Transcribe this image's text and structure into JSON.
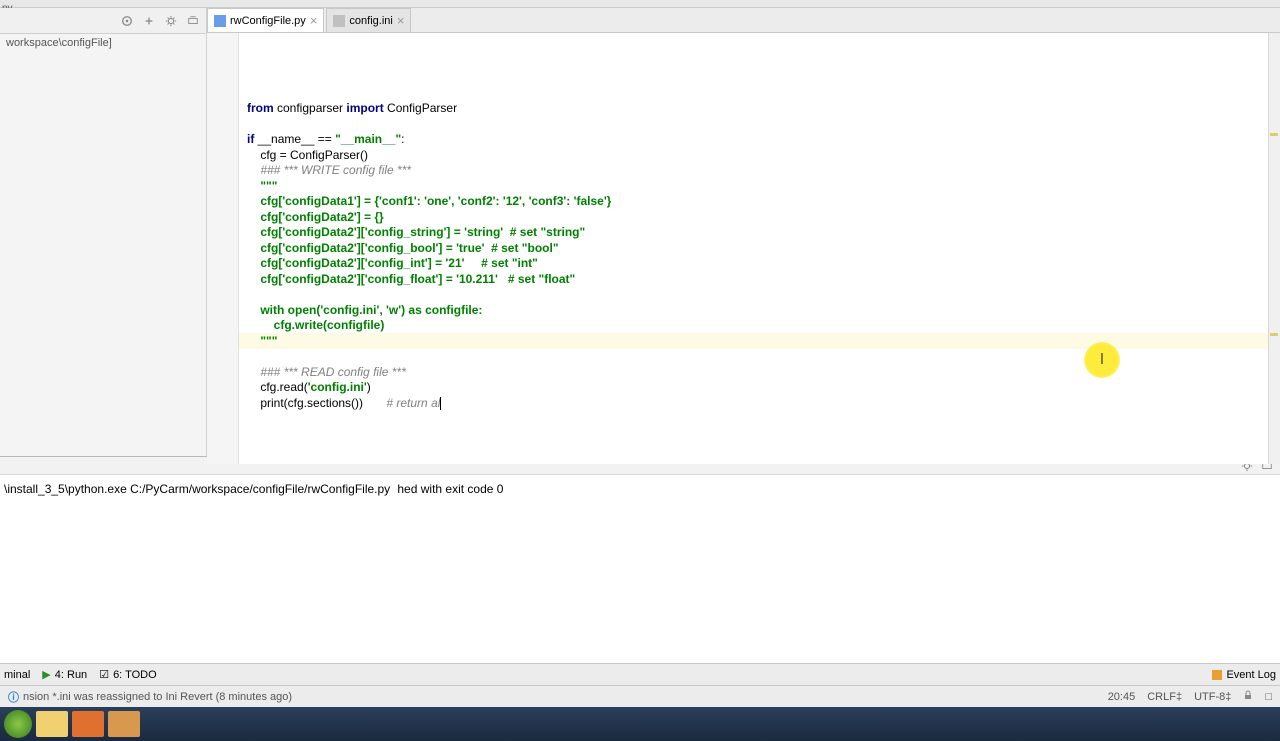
{
  "titlebar": {
    "suffix": "py"
  },
  "breadcrumb": {
    "path": "workspace\\configFile]"
  },
  "tabs": [
    {
      "label": "rwConfigFile.py",
      "active": true
    },
    {
      "label": "config.ini",
      "active": false
    }
  ],
  "code": {
    "l1a": "from ",
    "l1b": "configparser ",
    "l1c": "import ",
    "l1d": "ConfigParser",
    "l3a": "if ",
    "l3b": "__name__ == ",
    "l3c": "\"__main__\"",
    "l3d": ":",
    "l4": "    cfg = ConfigParser()",
    "l5": "    ### *** WRITE config file ***",
    "l6": "    \"\"\"",
    "l7a": "    cfg['configData1'] = {'conf1': 'one', 'conf2': '12', 'conf3': 'false'}",
    "l8": "    cfg['configData2'] = {}",
    "l9": "    cfg['configData2']['config_string'] = 'string'  # set \"string\"",
    "l10": "    cfg['configData2']['config_bool'] = 'true'  # set \"bool\"",
    "l11": "    cfg['configData2']['config_int'] = '21'     # set \"int\"",
    "l12": "    cfg['configData2']['config_float'] = '10.211'   # set \"float\"",
    "l14": "    with open('config.ini', 'w') as configfile:",
    "l15": "        cfg.write(configfile)",
    "l16": "    \"\"\"",
    "l18": "    ### *** READ config file ***",
    "l19a": "    cfg.read(",
    "l19b": "'config.ini'",
    "l19c": ")",
    "l20a": "    print(cfg.sections())       ",
    "l20b": "# return al"
  },
  "console": {
    "line1": "\\install_3_5\\python.exe C:/PyCarm/workspace/configFile/rwConfigFile.py",
    "line2": "hed with exit code 0"
  },
  "bottom_tabs": {
    "terminal": "minal",
    "run": "4: Run",
    "todo": "6: TODO",
    "event_log": "Event Log"
  },
  "status": {
    "message": "nsion *.ini was reassigned to Ini Revert (8 minutes ago)",
    "position": "20:45",
    "line_sep": "CRLF‡",
    "encoding": "UTF-8‡"
  },
  "cursor_highlight_char": "I"
}
